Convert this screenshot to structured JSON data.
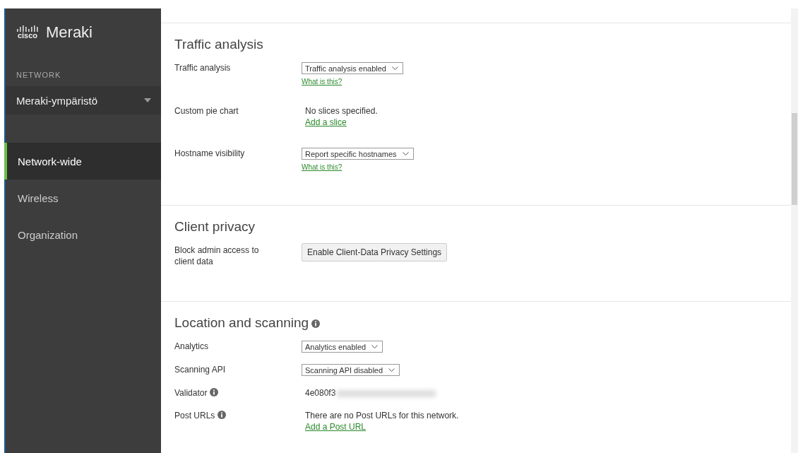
{
  "sidebar": {
    "brand": "cisco",
    "product": "Meraki",
    "network_label": "NETWORK",
    "network_name": "Meraki-ympäristö",
    "items": [
      {
        "label": "Network-wide",
        "selected": true
      },
      {
        "label": "Wireless",
        "selected": false
      },
      {
        "label": "Organization",
        "selected": false
      }
    ]
  },
  "sections": [
    {
      "title": "Traffic analysis",
      "rows": [
        {
          "label": "Traffic analysis",
          "kind": "select",
          "value": "Traffic analysis enabled",
          "help": "What is this?"
        },
        {
          "label": "Custom pie chart",
          "kind": "text",
          "text": "No slices specified.",
          "link": "Add a slice"
        },
        {
          "label": "Hostname visibility",
          "kind": "select",
          "value": "Report specific hostnames",
          "help": "What is this?"
        }
      ]
    },
    {
      "title": "Client privacy",
      "rows": [
        {
          "label": "Block admin access to client data",
          "kind": "button",
          "text": "Enable Client-Data Privacy Settings"
        }
      ]
    },
    {
      "title": "Location and scanning",
      "info": true,
      "rows": [
        {
          "label": "Analytics",
          "kind": "select",
          "value": "Analytics enabled"
        },
        {
          "label": "Scanning API",
          "kind": "select",
          "value": "Scanning API disabled"
        },
        {
          "label": "Validator",
          "info": true,
          "kind": "redacted",
          "text": "4e080f3"
        },
        {
          "label": "Post URLs",
          "info": true,
          "kind": "text",
          "text": "There are no Post URLs for this network.",
          "link": "Add a Post URL"
        }
      ]
    }
  ]
}
